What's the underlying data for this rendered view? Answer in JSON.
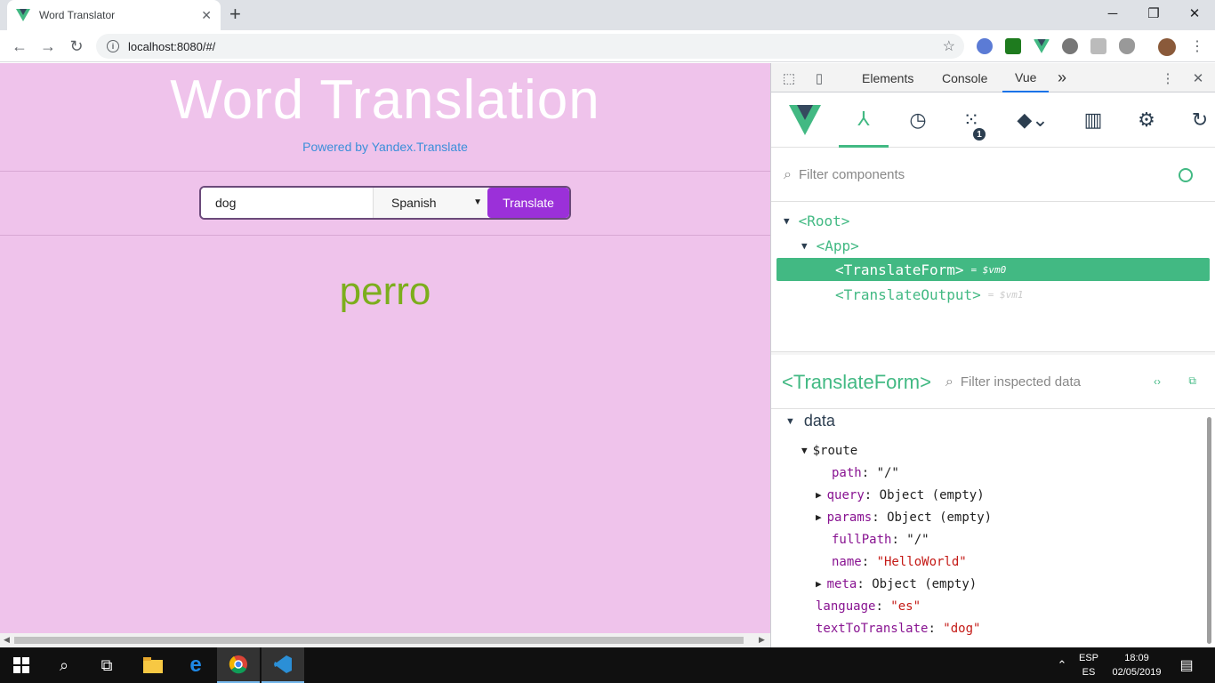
{
  "browser": {
    "tab_title": "Word Translator",
    "tab_close": "✕",
    "new_tab": "+",
    "url": "localhost:8080/#/",
    "window_controls": {
      "minimize": "─",
      "restore": "❐",
      "close": "✕"
    }
  },
  "page": {
    "title": "Word Translation",
    "powered_by": "Powered by Yandex.Translate",
    "form": {
      "word_value": "dog",
      "language_selected": "Spanish",
      "translate_label": "Translate"
    },
    "result": "perro",
    "colors": {
      "background": "#efc3eb",
      "button": "#9b30d9",
      "result": "#7cae1d",
      "link": "#3b8fd9"
    }
  },
  "devtools": {
    "tabs": [
      "Elements",
      "Console",
      "Vue"
    ],
    "more": "»",
    "active_tab": "Vue",
    "events_badge": "1",
    "filter_components_placeholder": "Filter components",
    "tree": [
      {
        "tag": "Root",
        "vm": ""
      },
      {
        "tag": "App",
        "vm": ""
      },
      {
        "tag": "TranslateForm",
        "vm": "= $vm0"
      },
      {
        "tag": "TranslateOutput",
        "vm": "= $vm1"
      }
    ],
    "inspector": {
      "component": "<TranslateForm>",
      "filter_placeholder": "Filter inspected data",
      "section": "data",
      "props": [
        {
          "key": "$route",
          "value": ""
        },
        {
          "key": "path",
          "value": "\"/\""
        },
        {
          "key": "query",
          "value": "Object (empty)"
        },
        {
          "key": "params",
          "value": "Object (empty)"
        },
        {
          "key": "fullPath",
          "value": "\"/\""
        },
        {
          "key": "name",
          "value": "\"HelloWorld\""
        },
        {
          "key": "meta",
          "value": "Object (empty)"
        },
        {
          "key": "language",
          "value": "\"es\""
        },
        {
          "key": "textToTranslate",
          "value": "\"dog\""
        }
      ]
    }
  },
  "taskbar": {
    "lang_top": "ESP",
    "lang_bottom": "ES",
    "time": "18:09",
    "date": "02/05/2019"
  }
}
